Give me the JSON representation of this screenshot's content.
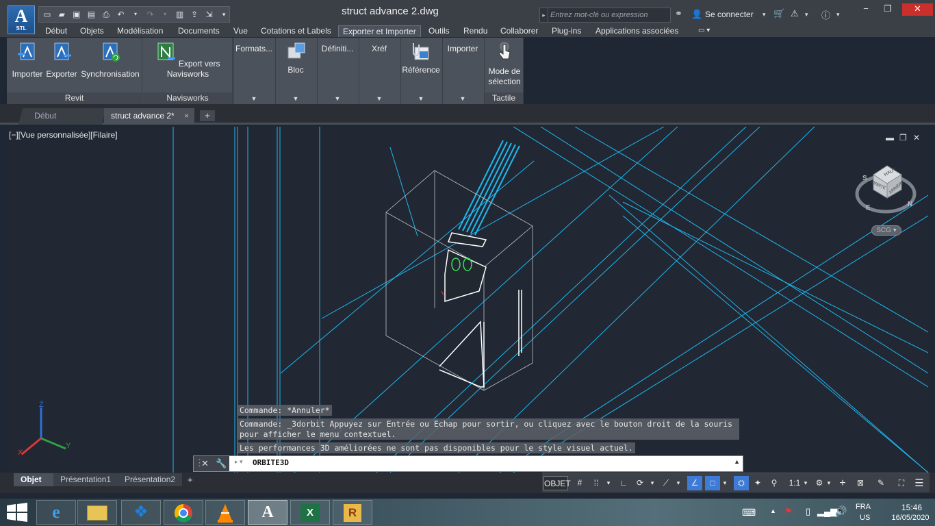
{
  "app": {
    "logo_text": "A",
    "logo_sub": "STL",
    "document_title": "struct advance 2.dwg",
    "search_placeholder": "Entrez mot-clé ou expression",
    "signin_label": "Se connecter"
  },
  "menu_tabs": [
    "Début",
    "Objets",
    "Modélisation",
    "Documents",
    "Vue",
    "Cotations et Labels",
    "Exporter et Importer",
    "Outils",
    "Rendu",
    "Collaborer",
    "Plug-ins",
    "Applications associées"
  ],
  "active_menu_tab": "Exporter et Importer",
  "ribbon": {
    "revit": {
      "title": "Revit",
      "buttons": [
        "Importer",
        "Exporter",
        "Synchronisation"
      ]
    },
    "navisworks": {
      "title": "Navisworks",
      "button": "Export vers Navisworks"
    },
    "dropdowns": [
      "Formats...",
      "Bloc",
      "Définiti...",
      "Xréf",
      "Référence",
      "Importer"
    ],
    "tactile": {
      "title": "Tactile",
      "button_line1": "Mode de",
      "button_line2": "sélection"
    }
  },
  "doc_tabs": {
    "start": "Début",
    "active": "struct advance 2*",
    "close": "×",
    "add": "+"
  },
  "viewport": {
    "label": "[−][Vue personnalisée][Filaire]",
    "viewcube_top": "HAUT",
    "viewcube_left": "ORBITE",
    "viewcube_right": "ARRIÈRE",
    "compass_s": "S",
    "compass_e": "E",
    "compass_n": "N",
    "ucs_label": "SCG",
    "axis_x": "X",
    "axis_y": "Y",
    "axis_z": "Z"
  },
  "command": {
    "history": [
      "Commande: *Annuler*",
      "Commande: _3dorbit Appuyez sur Entrée ou Echap pour sortir, ou cliquez avec le bouton droit de la souris",
      "pour afficher le menu contextuel.",
      "Les performances 3D améliorées ne sont pas disponibles pour le style visuel actuel."
    ],
    "current_input": "ORBITE3D"
  },
  "layout_tabs": [
    "Objet",
    "Présentation1",
    "Présentation2"
  ],
  "status": {
    "space": "OBJET",
    "scale": "1:1"
  },
  "taskbar": {
    "lang_line1": "FRA",
    "lang_line2": "US",
    "time": "15:46",
    "date": "16/05/2020"
  },
  "colors": {
    "accent": "#3d7bd6",
    "wire_cyan": "#1fb8f0",
    "wire_white": "#e8e8e8",
    "viewport_bg": "#212834",
    "close_red": "#c9302c"
  }
}
